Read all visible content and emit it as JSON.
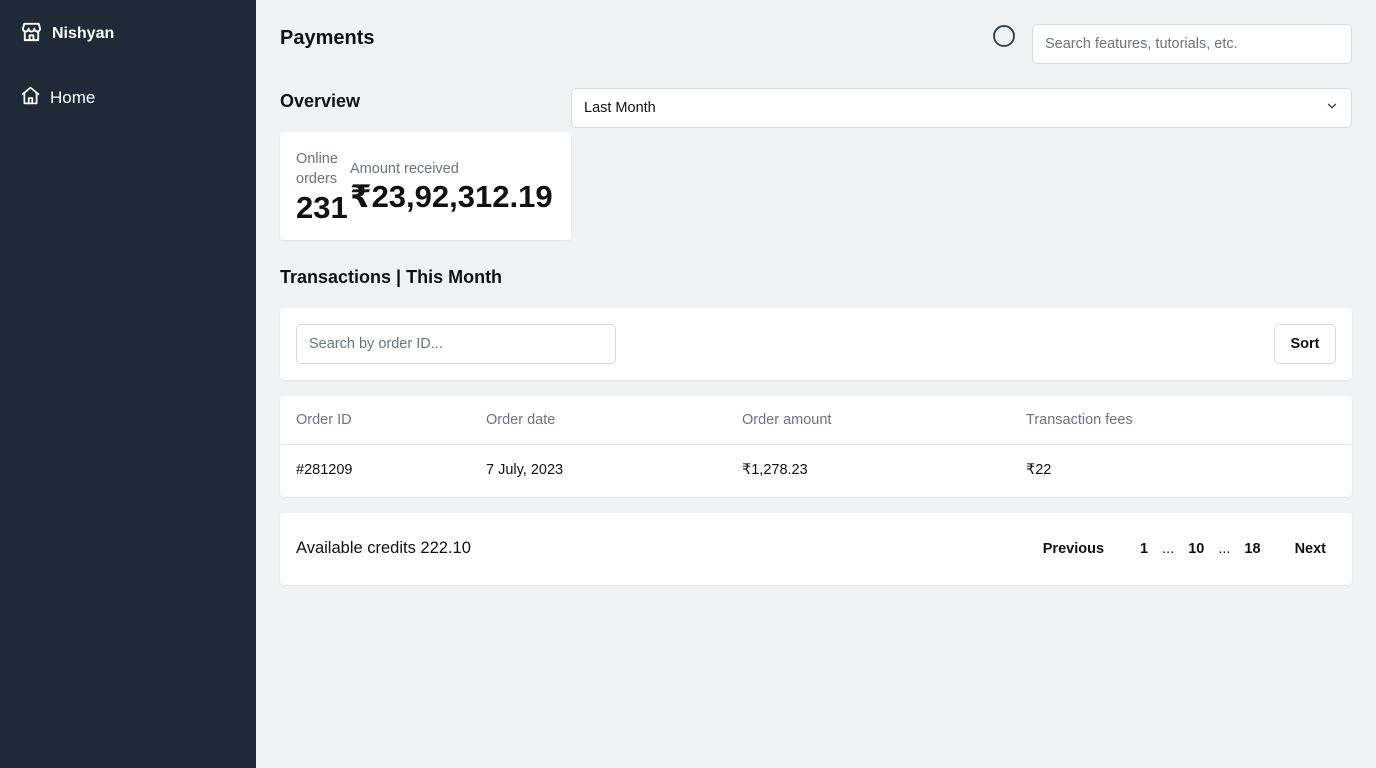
{
  "sidebar": {
    "brand_name": "Nishyan",
    "brand_icon": "store-icon",
    "items": [
      {
        "label": "Home",
        "icon": "home-icon"
      }
    ]
  },
  "header": {
    "title": "Payments",
    "search_placeholder": "Search features, tutorials, etc."
  },
  "overview": {
    "title": "Overview",
    "period": "Last Month",
    "stats": {
      "orders_label": "Online orders",
      "orders_value": "231",
      "amount_label": "Amount received",
      "amount_value": "₹23,92,312.19"
    }
  },
  "transactions": {
    "title": "Transactions | This Month",
    "search_placeholder": "Search by order ID...",
    "sort_label": "Sort",
    "columns": [
      "Order ID",
      "Order date",
      "Order amount",
      "Transaction fees"
    ],
    "rows": [
      [
        "#281209",
        "7 July, 2023",
        "₹1,278.23",
        "₹22"
      ]
    ]
  },
  "footer": {
    "credits": "Available credits 222.10",
    "pagination": {
      "previous": "Previous",
      "pages": [
        "1",
        "...",
        "10",
        "...",
        "18"
      ],
      "next": "Next"
    }
  },
  "colors": {
    "sidebar_bg": "#1f2937",
    "page_bg": "#f1f2f4",
    "muted_text": "#6b7280"
  }
}
